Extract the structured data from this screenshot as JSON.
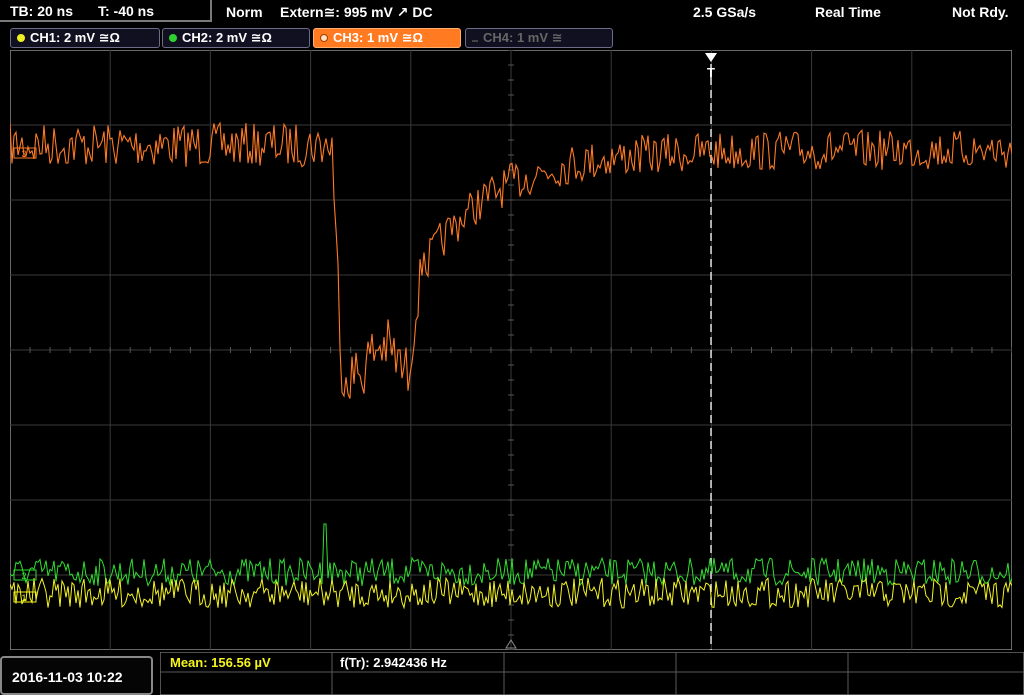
{
  "header": {
    "timebase": "TB: 20 ns",
    "trigger_time": "T: -40 ns",
    "trigger_mode": "Norm",
    "trigger_source": "Extern≅: 995 mV ↗ DC",
    "sample_rate": "2.5 GSa/s",
    "acq_mode": "Real Time",
    "status": "Not Rdy."
  },
  "channels": [
    {
      "label": "CH1: 2 mV ≅Ω",
      "color": "#f0f020",
      "active": true
    },
    {
      "label": "CH2: 2 mV ≅Ω",
      "color": "#30d030",
      "active": true
    },
    {
      "label": "CH3: 1 mV ≅Ω",
      "color": "#ff7a20",
      "active": true
    },
    {
      "label": "CH4: 1 mV ≅",
      "color": "#666666",
      "active": false
    }
  ],
  "markers": {
    "trigger_marker": "T",
    "ch1_marker": "1",
    "ch2_marker": "2",
    "ch3_marker": "3"
  },
  "measurements": {
    "mean": "Mean: 156.56 µV",
    "freq": "f(Tr): 2.942436 Hz"
  },
  "datetime": "2016-11-03 10:22"
}
